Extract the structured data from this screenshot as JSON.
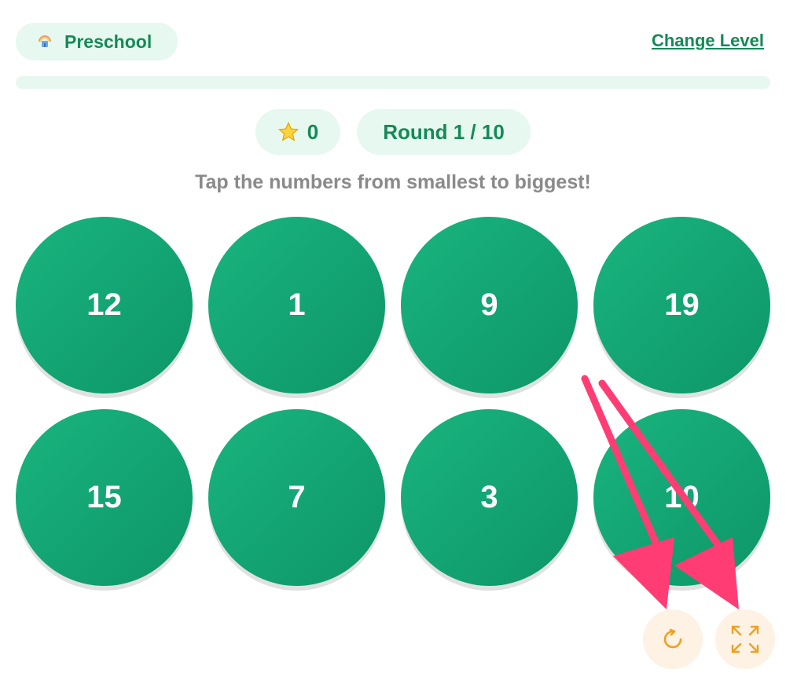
{
  "header": {
    "level_label": "Preschool",
    "level_icon": "rainbow-house-icon",
    "change_level_label": "Change Level"
  },
  "progress": {
    "fraction": 0.0
  },
  "stats": {
    "stars": "0",
    "star_icon": "star-icon",
    "round_label": "Round 1 / 10"
  },
  "instruction": "Tap the numbers from smallest to biggest!",
  "numbers": [
    "12",
    "1",
    "9",
    "19",
    "15",
    "7",
    "3",
    "10"
  ],
  "controls": {
    "restart_icon": "restart-icon",
    "fullscreen_icon": "fullscreen-icon"
  },
  "colors": {
    "accent": "#148a58",
    "button_green": "#13a673",
    "pill_bg": "#e6f8ef",
    "control_bg": "#fdf2e4",
    "control_icon": "#f0a020",
    "annotation_arrow": "#ff3d74"
  }
}
